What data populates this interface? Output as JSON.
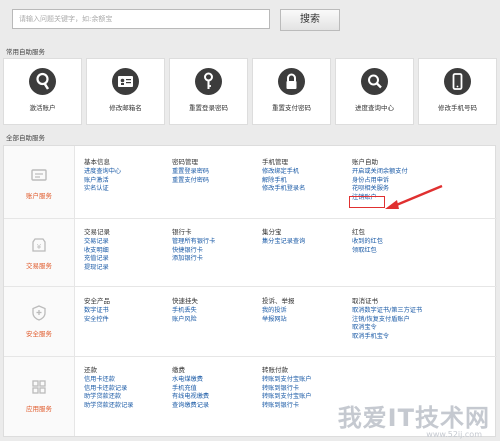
{
  "search": {
    "placeholder": "请输入问题关键字，如:余额宝",
    "button": "搜索"
  },
  "sections": {
    "common": "常用自助服务",
    "all": "全部自助服务"
  },
  "tiles": [
    {
      "label": "激活账户",
      "icon": "key-circle-icon"
    },
    {
      "label": "修改邮箱名",
      "icon": "id-card-icon"
    },
    {
      "label": "重置登录密码",
      "icon": "key-icon"
    },
    {
      "label": "重置支付密码",
      "icon": "lock-icon"
    },
    {
      "label": "进度查询中心",
      "icon": "search-icon"
    },
    {
      "label": "修改手机号码",
      "icon": "phone-icon"
    }
  ],
  "panels": [
    {
      "name": "账户服务",
      "icon": "account-icon",
      "cols": [
        {
          "h": "基本信息",
          "links": [
            "进度查询中心",
            "账户激活",
            "实名认证"
          ]
        },
        {
          "h": "密码管理",
          "links": [
            "重置登录密码",
            "重置支付密码"
          ]
        },
        {
          "h": "手机管理",
          "links": [
            "修改绑定手机",
            "解除手机",
            "修改手机登录名"
          ]
        },
        {
          "h": "账户自助",
          "links": [
            "开启或关闭余额支付",
            "身份占用申诉",
            "花呗相关服务",
            "注销账户"
          ]
        }
      ]
    },
    {
      "name": "交易服务",
      "icon": "trade-icon",
      "cols": [
        {
          "h": "交易记录",
          "links": [
            "交易记录",
            "收支明细",
            "充值记录",
            "提现记录"
          ]
        },
        {
          "h": "银行卡",
          "links": [
            "管理所有银行卡",
            "快捷银行卡",
            "添加银行卡"
          ]
        },
        {
          "h": "集分宝",
          "links": [
            "集分宝记录查询"
          ]
        },
        {
          "h": "红包",
          "links": [
            "收到的红包",
            "领取红包"
          ]
        }
      ]
    },
    {
      "name": "安全服务",
      "icon": "shield-icon",
      "cols": [
        {
          "h": "安全产品",
          "links": [
            "数字证书",
            "安全控件"
          ]
        },
        {
          "h": "快速挂失",
          "links": [
            "手机丢失",
            "账户风险"
          ]
        },
        {
          "h": "投诉、举报",
          "links": [
            "我的投诉",
            "举报网站"
          ]
        },
        {
          "h": "取消证书",
          "links": [
            "取消数字证书/第三方证书",
            "注销/恢复支付盾账户",
            "取消宝令",
            "取消手机宝令"
          ]
        }
      ]
    },
    {
      "name": "应用服务",
      "icon": "apps-icon",
      "cols": [
        {
          "h": "还款",
          "links": [
            "信用卡还款",
            "信用卡还款记录",
            "助学贷款还款",
            "助学贷款还款记录"
          ]
        },
        {
          "h": "缴费",
          "links": [
            "水电煤缴费",
            "手机充值",
            "有线电视缴费",
            "查询缴费记录"
          ]
        },
        {
          "h": "转账付款",
          "links": [
            "转账到支付宝账户",
            "转账到银行卡",
            "转账到支付宝账户",
            "转账到银行卡"
          ]
        },
        {
          "h": "",
          "links": []
        }
      ]
    }
  ],
  "watermark": {
    "text": "我爱IT技术网",
    "url": "www.52ij.com"
  }
}
